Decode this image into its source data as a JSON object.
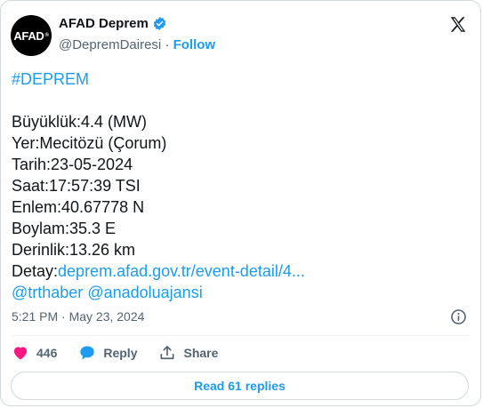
{
  "author": {
    "avatar_text": "AFAD",
    "avatar_mark": "®",
    "name": "AFAD Deprem",
    "handle": "@DepremDairesi",
    "separator": "·",
    "follow_label": "Follow"
  },
  "tweet": {
    "hashtag": "#DEPREM",
    "lines": [
      "Büyüklük:4.4 (MW)",
      "Yer:Mecitözü (Çorum)",
      "Tarih:23-05-2024",
      "Saat:17:57:39 TSI",
      "Enlem:40.67778 N",
      "Boylam:35.3 E",
      "Derinlik:13.26 km"
    ],
    "detail_label": "Detay:",
    "detail_link": "deprem.afad.gov.tr/event-detail/4...",
    "mention_1": "@trthaber",
    "mention_2": "@anadoluajansi",
    "timestamp": "5:21 PM · May 23, 2024"
  },
  "actions": {
    "like_count": "446",
    "reply_label": "Reply",
    "share_label": "Share",
    "read_replies_label": "Read 61 replies"
  },
  "colors": {
    "accent": "#1d9bf0",
    "like": "#f91880",
    "text": "#0f1419",
    "muted": "#536471"
  },
  "icons": [
    "verified-badge-icon",
    "x-logo-icon",
    "info-icon",
    "heart-icon",
    "reply-bubble-icon",
    "share-icon"
  ]
}
